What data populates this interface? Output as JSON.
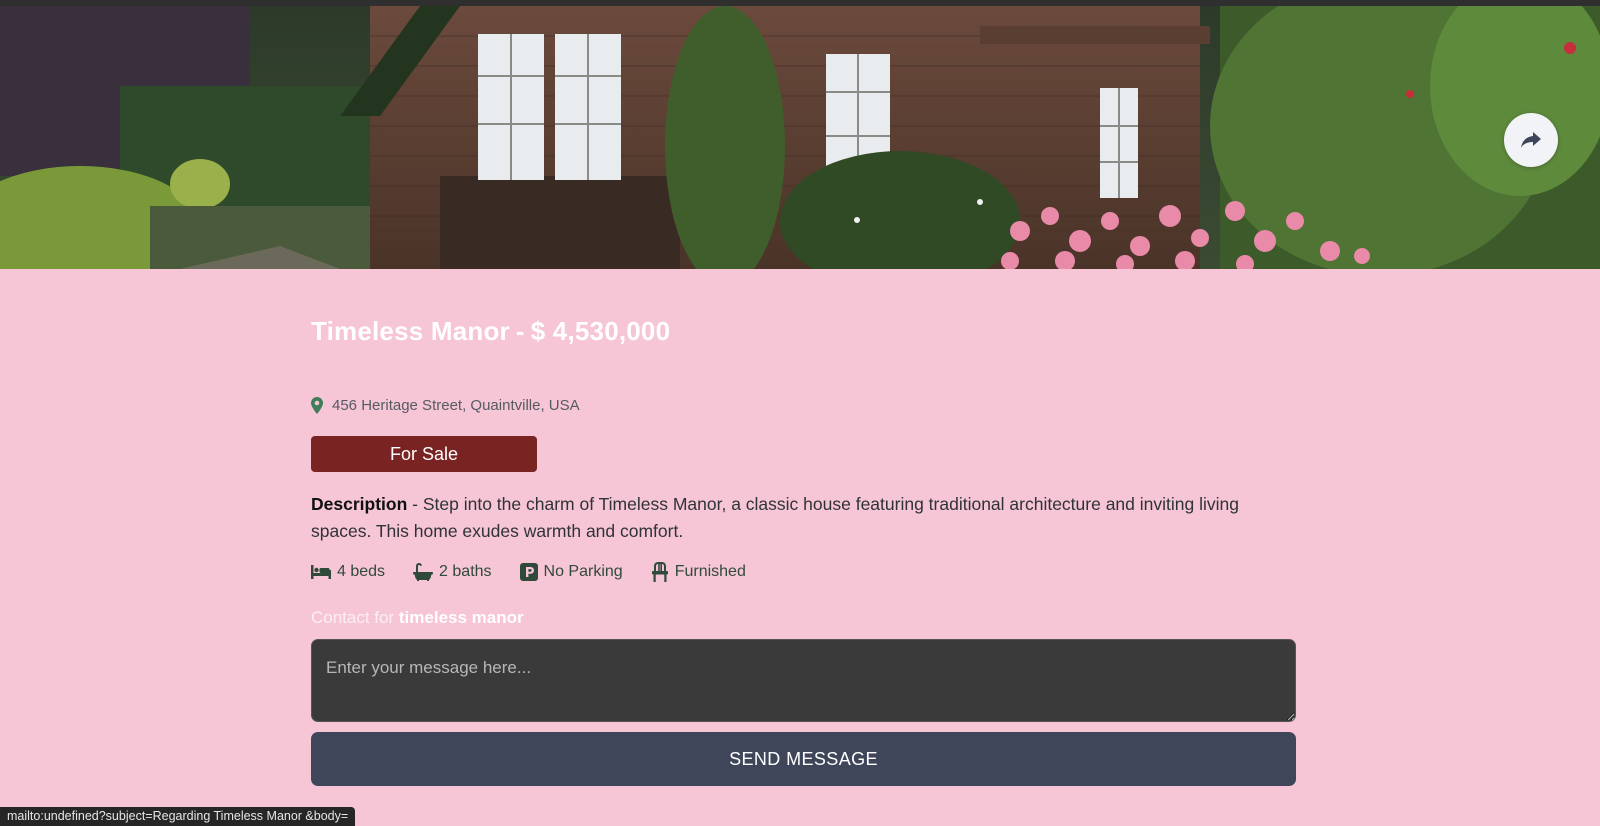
{
  "listing": {
    "name": "Timeless Manor",
    "separator": "-",
    "price": "$ 4,530,000",
    "address": "456 Heritage Street, Quaintville, USA",
    "status": "For Sale",
    "description_label": "Description",
    "description_separator": "-",
    "description": "Step into the charm of Timeless Manor, a classic house featuring traditional architecture and inviting living spaces. This home exudes warmth and comfort.",
    "features": [
      {
        "icon": "bed-icon",
        "label": "4 beds"
      },
      {
        "icon": "bath-icon",
        "label": "2 baths"
      },
      {
        "icon": "parking-icon",
        "label": "No Parking"
      },
      {
        "icon": "chair-icon",
        "label": "Furnished"
      }
    ]
  },
  "contact": {
    "prefix": "Contact for",
    "name": "timeless manor",
    "placeholder": "Enter your message here...",
    "send_label": "SEND MESSAGE"
  },
  "statusbar": {
    "url": "mailto:undefined?subject=Regarding Timeless Manor &body="
  },
  "icons": {
    "share": "share-icon",
    "location": "location-pin-icon"
  },
  "colors": {
    "page_background": "#f6c5d6",
    "status_badge": "#7a2323",
    "send_button": "#3f4659",
    "input_background": "#3a3a3a",
    "icon_green": "#3e7d57"
  }
}
